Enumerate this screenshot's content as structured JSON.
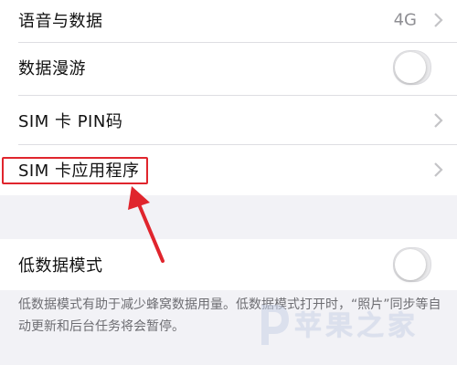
{
  "settings": {
    "voice_data": {
      "label": "语音与数据",
      "value": "4G"
    },
    "data_roaming": {
      "label": "数据漫游",
      "enabled": false
    },
    "sim_pin": {
      "label": "SIM 卡 PIN码"
    },
    "sim_apps": {
      "label": "SIM 卡应用程序"
    },
    "low_data_mode": {
      "label": "低数据模式",
      "enabled": false,
      "footnote": "低数据模式有助于减少蜂窝数据用量。低数据模式打开时，“照片”同步等自动更新和后台任务将会暂停。"
    }
  },
  "annotation": {
    "highlight_color": "#e0252d",
    "target": "sim_apps"
  },
  "watermark": {
    "text": "苹果之家",
    "icon": "p-logo-icon"
  },
  "colors": {
    "background": "#f2f2f6",
    "cell": "#ffffff",
    "secondary_text": "#8e8e93",
    "separator": "#dedee2"
  }
}
